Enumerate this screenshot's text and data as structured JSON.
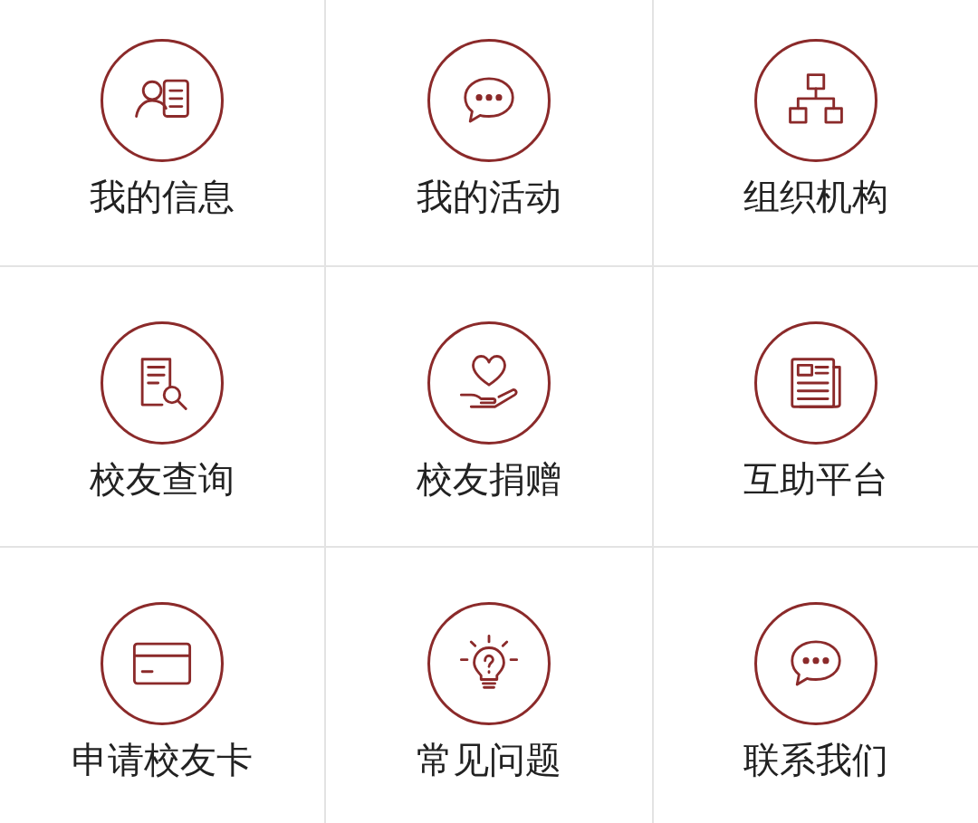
{
  "menu_items": [
    {
      "label": "我的信息"
    },
    {
      "label": "我的活动"
    },
    {
      "label": "组织机构"
    },
    {
      "label": "校友查询"
    },
    {
      "label": "校友捐赠"
    },
    {
      "label": "互助平台"
    },
    {
      "label": "申请校友卡"
    },
    {
      "label": "常见问题"
    },
    {
      "label": "联系我们"
    }
  ]
}
